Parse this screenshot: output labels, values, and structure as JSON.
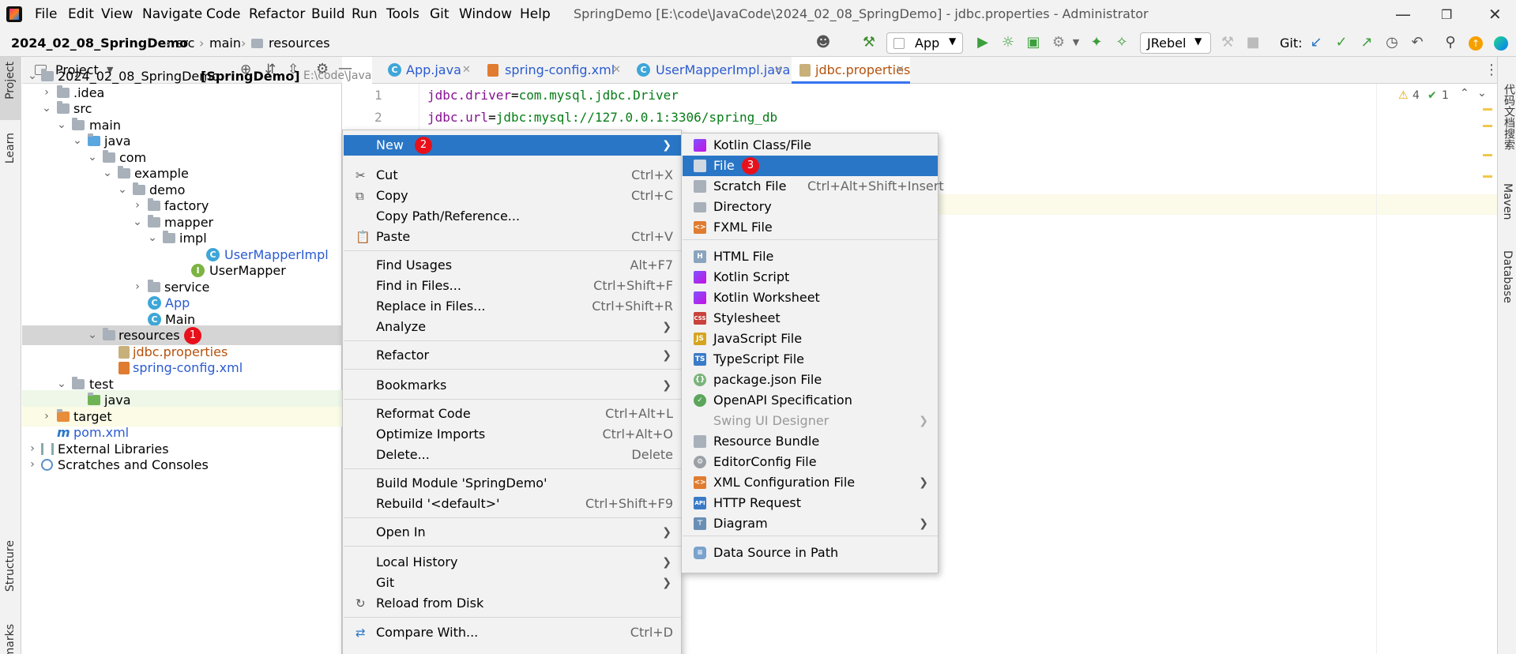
{
  "menubar": {
    "items": [
      "File",
      "Edit",
      "View",
      "Navigate",
      "Code",
      "Refactor",
      "Build",
      "Run",
      "Tools",
      "Git",
      "Window",
      "Help"
    ],
    "window_title": "SpringDemo [E:\\code\\JavaCode\\2024_02_08_SpringDemo] - jdbc.properties - Administrator"
  },
  "navbar": {
    "crumbs": [
      "2024_02_08_SpringDemo",
      "src",
      "main",
      "resources"
    ],
    "run_config": "App",
    "jrebel": "JRebel",
    "git_label": "Git:"
  },
  "left_stripe": {
    "project": "Project",
    "learn": "Learn",
    "structure": "Structure",
    "bookmarks": "marks"
  },
  "right_stripe": {
    "plugin": "代码文档搜索",
    "maven": "Maven",
    "database": "Database"
  },
  "project_panel": {
    "title": "Project",
    "tree": [
      {
        "label": "2024_02_08_SpringDemo",
        "bold_suffix": "[SpringDemo]",
        "path": "E:\\code\\Java"
      },
      {
        "label": ".idea"
      },
      {
        "label": "src"
      },
      {
        "label": "main"
      },
      {
        "label": "java"
      },
      {
        "label": "com"
      },
      {
        "label": "example"
      },
      {
        "label": "demo"
      },
      {
        "label": "factory"
      },
      {
        "label": "mapper"
      },
      {
        "label": "impl"
      },
      {
        "label": "UserMapperImpl"
      },
      {
        "label": "UserMapper"
      },
      {
        "label": "service"
      },
      {
        "label": "App"
      },
      {
        "label": "Main"
      },
      {
        "label": "resources",
        "badge": "1"
      },
      {
        "label": "jdbc.properties"
      },
      {
        "label": "spring-config.xml"
      },
      {
        "label": "test"
      },
      {
        "label": "java"
      },
      {
        "label": "target"
      },
      {
        "label": "pom.xml"
      },
      {
        "label": "External Libraries"
      },
      {
        "label": "Scratches and Consoles"
      }
    ]
  },
  "tabs": [
    {
      "label": "App.java"
    },
    {
      "label": "spring-config.xml"
    },
    {
      "label": "UserMapperImpl.java"
    },
    {
      "label": "jdbc.properties",
      "active": true
    }
  ],
  "editor": {
    "lines": [
      {
        "num": "1",
        "key": "jdbc.driver",
        "eq": "=",
        "val": "com.mysql.jdbc.Driver"
      },
      {
        "num": "2",
        "key": "jdbc.url",
        "eq": "=",
        "val": "jdbc:mysql://127.0.0.1:3306/spring_db"
      }
    ],
    "warnings": "4",
    "checks": "1"
  },
  "context_menu": {
    "items": [
      {
        "label": "New",
        "badge": "2",
        "sub": true,
        "selected": true
      },
      {
        "label": "Cut",
        "shortcut": "Ctrl+X"
      },
      {
        "label": "Copy",
        "shortcut": "Ctrl+C"
      },
      {
        "label": "Copy Path/Reference..."
      },
      {
        "label": "Paste",
        "shortcut": "Ctrl+V"
      },
      {
        "label": "Find Usages",
        "shortcut": "Alt+F7"
      },
      {
        "label": "Find in Files...",
        "shortcut": "Ctrl+Shift+F"
      },
      {
        "label": "Replace in Files...",
        "shortcut": "Ctrl+Shift+R"
      },
      {
        "label": "Analyze",
        "sub": true
      },
      {
        "label": "Refactor",
        "sub": true
      },
      {
        "label": "Bookmarks",
        "sub": true
      },
      {
        "label": "Reformat Code",
        "shortcut": "Ctrl+Alt+L"
      },
      {
        "label": "Optimize Imports",
        "shortcut": "Ctrl+Alt+O"
      },
      {
        "label": "Delete...",
        "shortcut": "Delete"
      },
      {
        "label": "Build Module 'SpringDemo'"
      },
      {
        "label": "Rebuild '<default>'",
        "shortcut": "Ctrl+Shift+F9"
      },
      {
        "label": "Open In",
        "sub": true
      },
      {
        "label": "Local History",
        "sub": true
      },
      {
        "label": "Git",
        "sub": true
      },
      {
        "label": "Reload from Disk"
      },
      {
        "label": "Compare With...",
        "shortcut": "Ctrl+D"
      }
    ]
  },
  "submenu": {
    "items": [
      {
        "label": "Kotlin Class/File"
      },
      {
        "label": "File",
        "badge": "3",
        "selected": true
      },
      {
        "label": "Scratch File",
        "shortcut": "Ctrl+Alt+Shift+Insert"
      },
      {
        "label": "Directory"
      },
      {
        "label": "FXML File"
      },
      {
        "label": "HTML File"
      },
      {
        "label": "Kotlin Script"
      },
      {
        "label": "Kotlin Worksheet"
      },
      {
        "label": "Stylesheet"
      },
      {
        "label": "JavaScript File"
      },
      {
        "label": "TypeScript File"
      },
      {
        "label": "package.json File"
      },
      {
        "label": "OpenAPI Specification"
      },
      {
        "label": "Swing UI Designer",
        "sub": true,
        "disabled": true
      },
      {
        "label": "Resource Bundle"
      },
      {
        "label": "EditorConfig File"
      },
      {
        "label": "XML Configuration File",
        "sub": true
      },
      {
        "label": "HTTP Request"
      },
      {
        "label": "Diagram",
        "sub": true
      },
      {
        "label": "Data Source in Path"
      }
    ]
  },
  "colors": {
    "selection": "#2a76c6",
    "badge": "#e8101a",
    "key": "#871094",
    "value": "#067d17"
  }
}
